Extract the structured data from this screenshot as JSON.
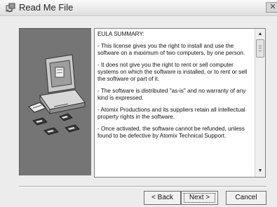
{
  "window": {
    "title": "Read Me File",
    "close_glyph": "✕",
    "title_icon": "setup-box-icon"
  },
  "eula": {
    "heading": "EULA SUMMARY:",
    "paragraphs": [
      "- This license gives you the right to install and use the software on a maximum of two computers, by one person.",
      "- It does not give you the right to rent or sell computer systems on which the software is installed, or to rent or sell the software or part of it.",
      "- The software is distributed \"as-is\" and no warranty of any kind is expressed.",
      "- Atomix Productions and its suppliers retain all intellectual property rights in the software.",
      "- Once activated, the software cannot be refunded, unless found to be defective by Atomix Technical Support."
    ]
  },
  "scrollbar": {
    "up_glyph": "▲",
    "down_glyph": "▼",
    "position_fraction": 0.0
  },
  "buttons": {
    "back_label": "< Back",
    "next_label": "Next >",
    "cancel_label": "Cancel"
  },
  "graphic": {
    "icon": "computer-setup-illustration",
    "panel_color": "#757575"
  }
}
